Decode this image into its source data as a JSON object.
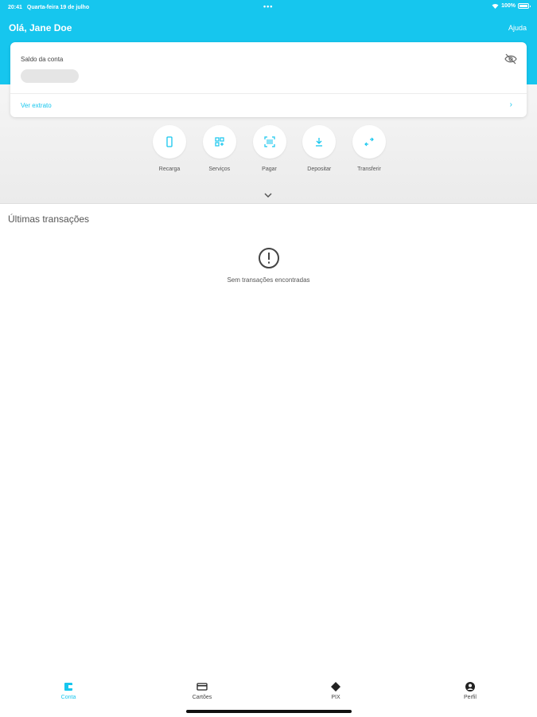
{
  "status_bar": {
    "time": "20:41",
    "date": "Quarta-feira 19 de julho",
    "battery": "100%"
  },
  "header": {
    "greeting": "Olá, Jane Doe",
    "help_label": "Ajuda"
  },
  "account_card": {
    "label": "Saldo da conta",
    "statement_link": "Ver extrato",
    "balance_hidden": true
  },
  "actions": [
    {
      "label": "Recarga",
      "icon": "phone-icon"
    },
    {
      "label": "Serviços",
      "icon": "services-grid-icon"
    },
    {
      "label": "Pagar",
      "icon": "barcode-scan-icon"
    },
    {
      "label": "Depositar",
      "icon": "download-icon"
    },
    {
      "label": "Transferir",
      "icon": "transfer-icon"
    }
  ],
  "transactions": {
    "title": "Últimas transações",
    "empty_message": "Sem transações encontradas"
  },
  "tabs": [
    {
      "label": "Conta",
      "icon": "wallet-icon",
      "active": true
    },
    {
      "label": "Cartões",
      "icon": "card-icon",
      "active": false
    },
    {
      "label": "PIX",
      "icon": "pix-icon",
      "active": false
    },
    {
      "label": "Perfil",
      "icon": "profile-icon",
      "active": false
    }
  ],
  "colors": {
    "brand": "#16c6ee",
    "text": "#555555"
  }
}
